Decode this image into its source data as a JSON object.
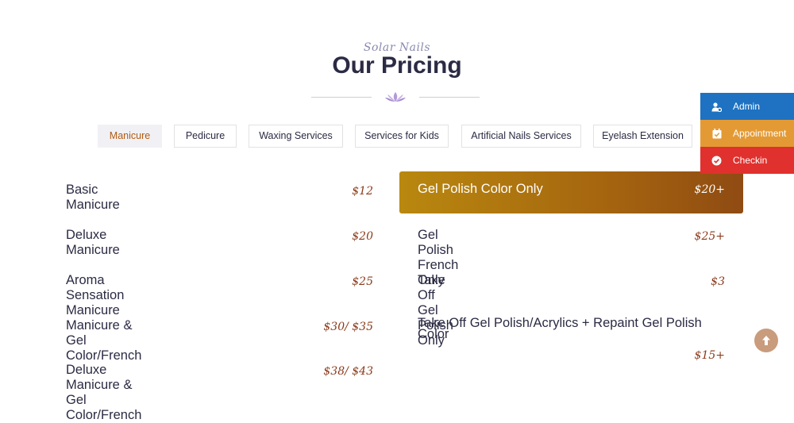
{
  "header": {
    "eyebrow": "Solar Nails",
    "title": "Our Pricing"
  },
  "tabs": [
    {
      "label": "Manicure",
      "active": true
    },
    {
      "label": "Pedicure",
      "active": false
    },
    {
      "label": "Waxing Services",
      "active": false
    },
    {
      "label": "Services for Kids",
      "active": false
    },
    {
      "label": "Artificial Nails Services",
      "active": false
    },
    {
      "label": "Eyelash Extension",
      "active": false
    }
  ],
  "left_items": [
    {
      "name": "Basic Manicure",
      "price": "$12"
    },
    {
      "name": "Deluxe Manicure",
      "price": "$20"
    },
    {
      "name": "Aroma Sensation Manicure",
      "price": "$25"
    },
    {
      "name": "Manicure & Gel Color/French",
      "price": "$30/ $35"
    },
    {
      "name": "Deluxe Manicure & Gel Color/French",
      "price": "$38/ $43"
    }
  ],
  "right_items": [
    {
      "name": "Gel Polish Color Only",
      "price": "$20+",
      "highlighted": true
    },
    {
      "name": "Gel Polish French Only",
      "price": "$25+"
    },
    {
      "name": "Take Off Gel Polish Only",
      "price": "$3"
    },
    {
      "name": "Take Off Gel Polish/Acrylics + Repaint Gel Polish Color",
      "price": "$15+"
    }
  ],
  "side_buttons": {
    "admin": {
      "label": "Admin",
      "color": "#1e72c1",
      "icon": "user-gear-icon"
    },
    "appointment": {
      "label": "Appointment",
      "color": "#e49a34",
      "icon": "calendar-check-icon"
    },
    "checkin": {
      "label": "Checkin",
      "color": "#e0312e",
      "icon": "check-circle-icon"
    }
  },
  "colors": {
    "accent": "#b35a10",
    "highlight_start": "#b9880f",
    "highlight_end": "#8f4b12",
    "price": "#8b3a1a",
    "scroll_top": "#c89c7c"
  }
}
